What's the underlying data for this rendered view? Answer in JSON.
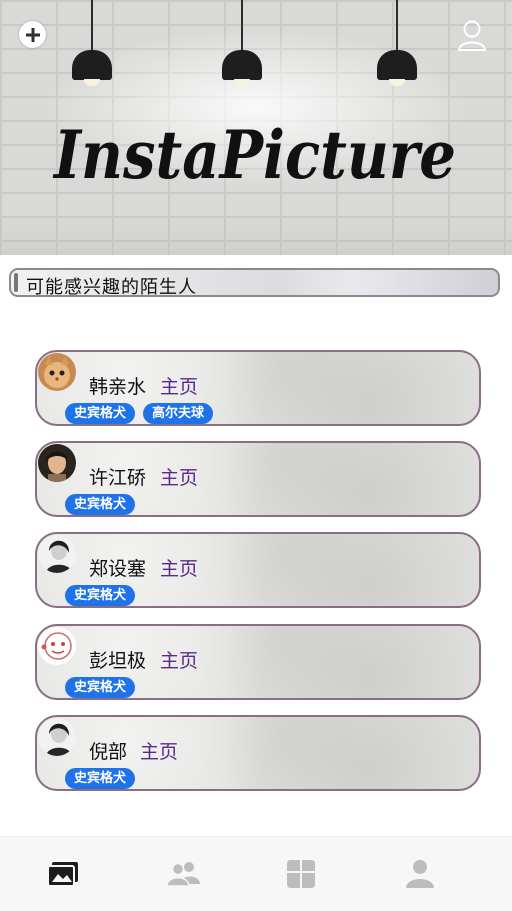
{
  "app": {
    "logo_text": "InstaPicture"
  },
  "header": {
    "add_icon": "plus-circle-icon",
    "profile_icon": "user-outline-icon"
  },
  "section": {
    "title": "可能感兴趣的陌生人"
  },
  "people": [
    {
      "name": "韩亲水",
      "homepage": "主页",
      "tags": [
        "史宾格犬",
        "高尔夫球"
      ],
      "avatar": "cat-avatar"
    },
    {
      "name": "许江硚",
      "homepage": "主页",
      "tags": [
        "史宾格犬"
      ],
      "avatar": "portrait-avatar"
    },
    {
      "name": "郑设塞",
      "homepage": "主页",
      "tags": [
        "史宾格犬"
      ],
      "avatar": "bw-portrait-avatar"
    },
    {
      "name": "彭坦极",
      "homepage": "主页",
      "tags": [
        "史宾格犬"
      ],
      "avatar": "cartoon-avatar"
    },
    {
      "name": "倪部",
      "homepage": "主页",
      "tags": [
        "史宾格犬"
      ],
      "avatar": "bw-portrait-avatar"
    }
  ],
  "nav": [
    {
      "icon": "photos-icon",
      "active": true
    },
    {
      "icon": "friends-icon",
      "active": false
    },
    {
      "icon": "discover-icon",
      "active": false
    },
    {
      "icon": "profile-icon",
      "active": false
    }
  ],
  "colors": {
    "tag": "#1e73e8",
    "homepage_link": "#5a2a8a",
    "card_border": "#8a6e84",
    "nav_active": "#1c1c1c",
    "nav_inactive": "#bdbdbd"
  }
}
